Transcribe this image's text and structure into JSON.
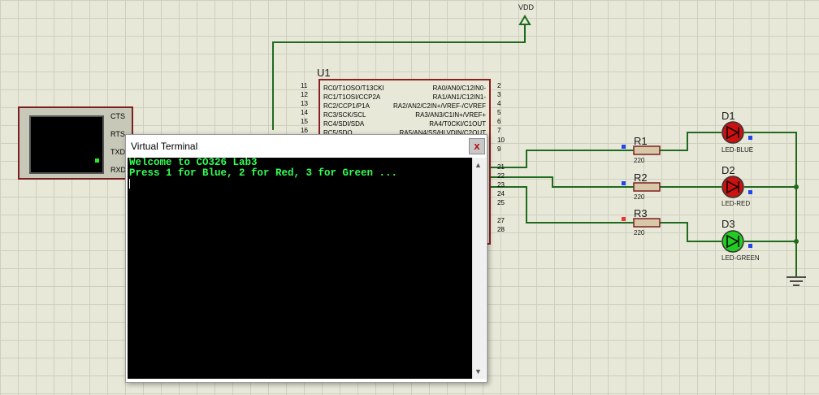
{
  "schematic": {
    "power_label": "VDD",
    "mcu": {
      "ref": "U1",
      "left_pins": [
        {
          "num": "11",
          "name": "RC0/T1OSO/T13CKI"
        },
        {
          "num": "12",
          "name": "RC1/T1OSI/CCP2A"
        },
        {
          "num": "13",
          "name": "RC2/CCP1/P1A"
        },
        {
          "num": "14",
          "name": "RC3/SCK/SCL"
        },
        {
          "num": "15",
          "name": "RC4/SDI/SDA"
        },
        {
          "num": "16",
          "name": "RC5/SDO"
        }
      ],
      "right_pins": [
        {
          "num": "2",
          "name": "RA0/AN0/C12IN0-"
        },
        {
          "num": "3",
          "name": "RA1/AN1/C12IN1-"
        },
        {
          "num": "4",
          "name": "RA2/AN2/C2IN+/VREF-/CVREF"
        },
        {
          "num": "5",
          "name": "RA3/AN3/C1IN+/VREF+"
        },
        {
          "num": "6",
          "name": "RA4/T0CKI/C1OUT"
        },
        {
          "num": "7",
          "name": "RA5/AN4/SS/HLVDIN/C2OUT"
        }
      ],
      "extra_pins": [
        "10",
        "9",
        "21",
        "22",
        "23",
        "24",
        "25",
        "27",
        "28"
      ]
    },
    "serial_port": {
      "signals": [
        "CTS",
        "RTS",
        "TXD",
        "RXD"
      ]
    },
    "resistors": [
      {
        "ref": "R1",
        "value": "220"
      },
      {
        "ref": "R2",
        "value": "220"
      },
      {
        "ref": "R3",
        "value": "220"
      }
    ],
    "leds": [
      {
        "ref": "D1",
        "type": "LED-BLUE",
        "color": "#cc1111"
      },
      {
        "ref": "D2",
        "type": "LED-RED",
        "color": "#cc1111"
      },
      {
        "ref": "D3",
        "type": "LED-GREEN",
        "color": "#22cc22"
      }
    ]
  },
  "terminal": {
    "title": "Virtual Terminal",
    "close_label": "x",
    "lines": [
      "Welcome to CO326 Lab3",
      "Press 1 for Blue, 2 for Red, 3 for Green ..."
    ]
  },
  "colors": {
    "wire": "#1f6a1f",
    "component_border": "#8a2020",
    "terminal_text": "#33ff55"
  }
}
